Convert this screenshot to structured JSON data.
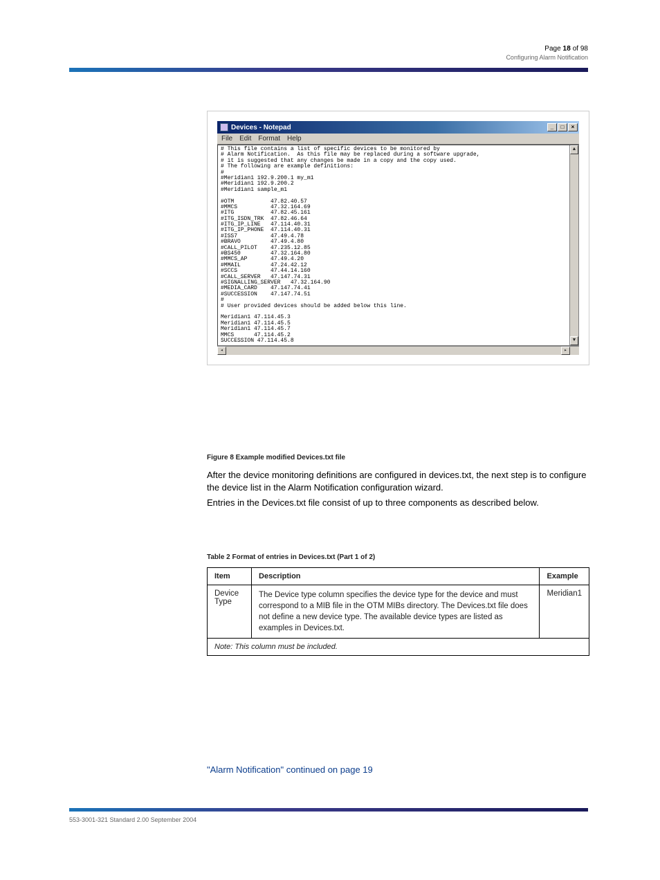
{
  "page": {
    "number": "18",
    "running_header": "Configuring Alarm Notification",
    "figure_caption": "Figure 8   Example modified Devices.txt file",
    "footer": "553-3001-321   Standard 2.00   September 2004"
  },
  "body": {
    "para1": "After the device monitoring definitions are configured in devices.txt, the next step is to configure the device list in the Alarm Notification configuration wizard.",
    "para2": "Entries in the Devices.txt file consist of up to three components as described below.",
    "table_title_small": "Table 2   Format of entries in Devices.txt  (Part 1 of 2)",
    "continued": "\"Alarm Notification\" continued on page 19"
  },
  "notepad": {
    "title": "Devices - Notepad",
    "menus": [
      "File",
      "Edit",
      "Format",
      "Help"
    ],
    "lines": [
      "# This file contains a list of specific devices to be monitored by",
      "# Alarm Notification.  As this file may be replaced during a software upgrade,",
      "# it is suggested that any changes be made in a copy and the copy used.",
      "# The following are example definitions:",
      "#",
      "#Meridian1 192.9.200.1 my_m1",
      "#Meridian1 192.9.200.2",
      "#Meridian1 sample_m1",
      "",
      "#OTM           47.82.40.57",
      "#MMCS          47.32.164.69",
      "#ITG           47.82.45.161",
      "#ITG_ISDN_TRK  47.82.46.64",
      "#ITG_IP_LINE   47.114.40.31",
      "#ITG_IP_PHONE  47.114.40.31",
      "#ISS7          47.49.4.78",
      "#BRAVO         47.49.4.80",
      "#CALL_PILOT    47.235.12.85",
      "#BS450         47.32.164.80",
      "#MMCS_AP       47.49.4.20",
      "#MMAIL         47.24.42.12",
      "#SCCS          47.44.14.160",
      "#CALL_SERVER   47.147.74.31",
      "#SIGNALLING_SERVER   47.32.164.90",
      "#MEDIA_CARD    47.147.74.41",
      "#SUCCESSION    47.147.74.51",
      "#",
      "# User provided devices should be added below this line.",
      "",
      "Meridian1 47.114.45.3",
      "Meridian1 47.114.45.5",
      "Meridian1 47.114.45.7",
      "MMCS      47.114.45.2",
      "SUCCESSION 47.114.45.8"
    ]
  },
  "table": {
    "headers": [
      "Item",
      "Description",
      "Example"
    ],
    "row1": {
      "item": "Device Type",
      "desc": "The Device type column specifies the device type for the device and must correspond to a MIB file in the OTM MIBs directory. The Devices.txt file does not define a new device type. The available device types are listed as examples in Devices.txt.",
      "example": "Meridian1"
    },
    "note": "Note: This column must be included."
  }
}
